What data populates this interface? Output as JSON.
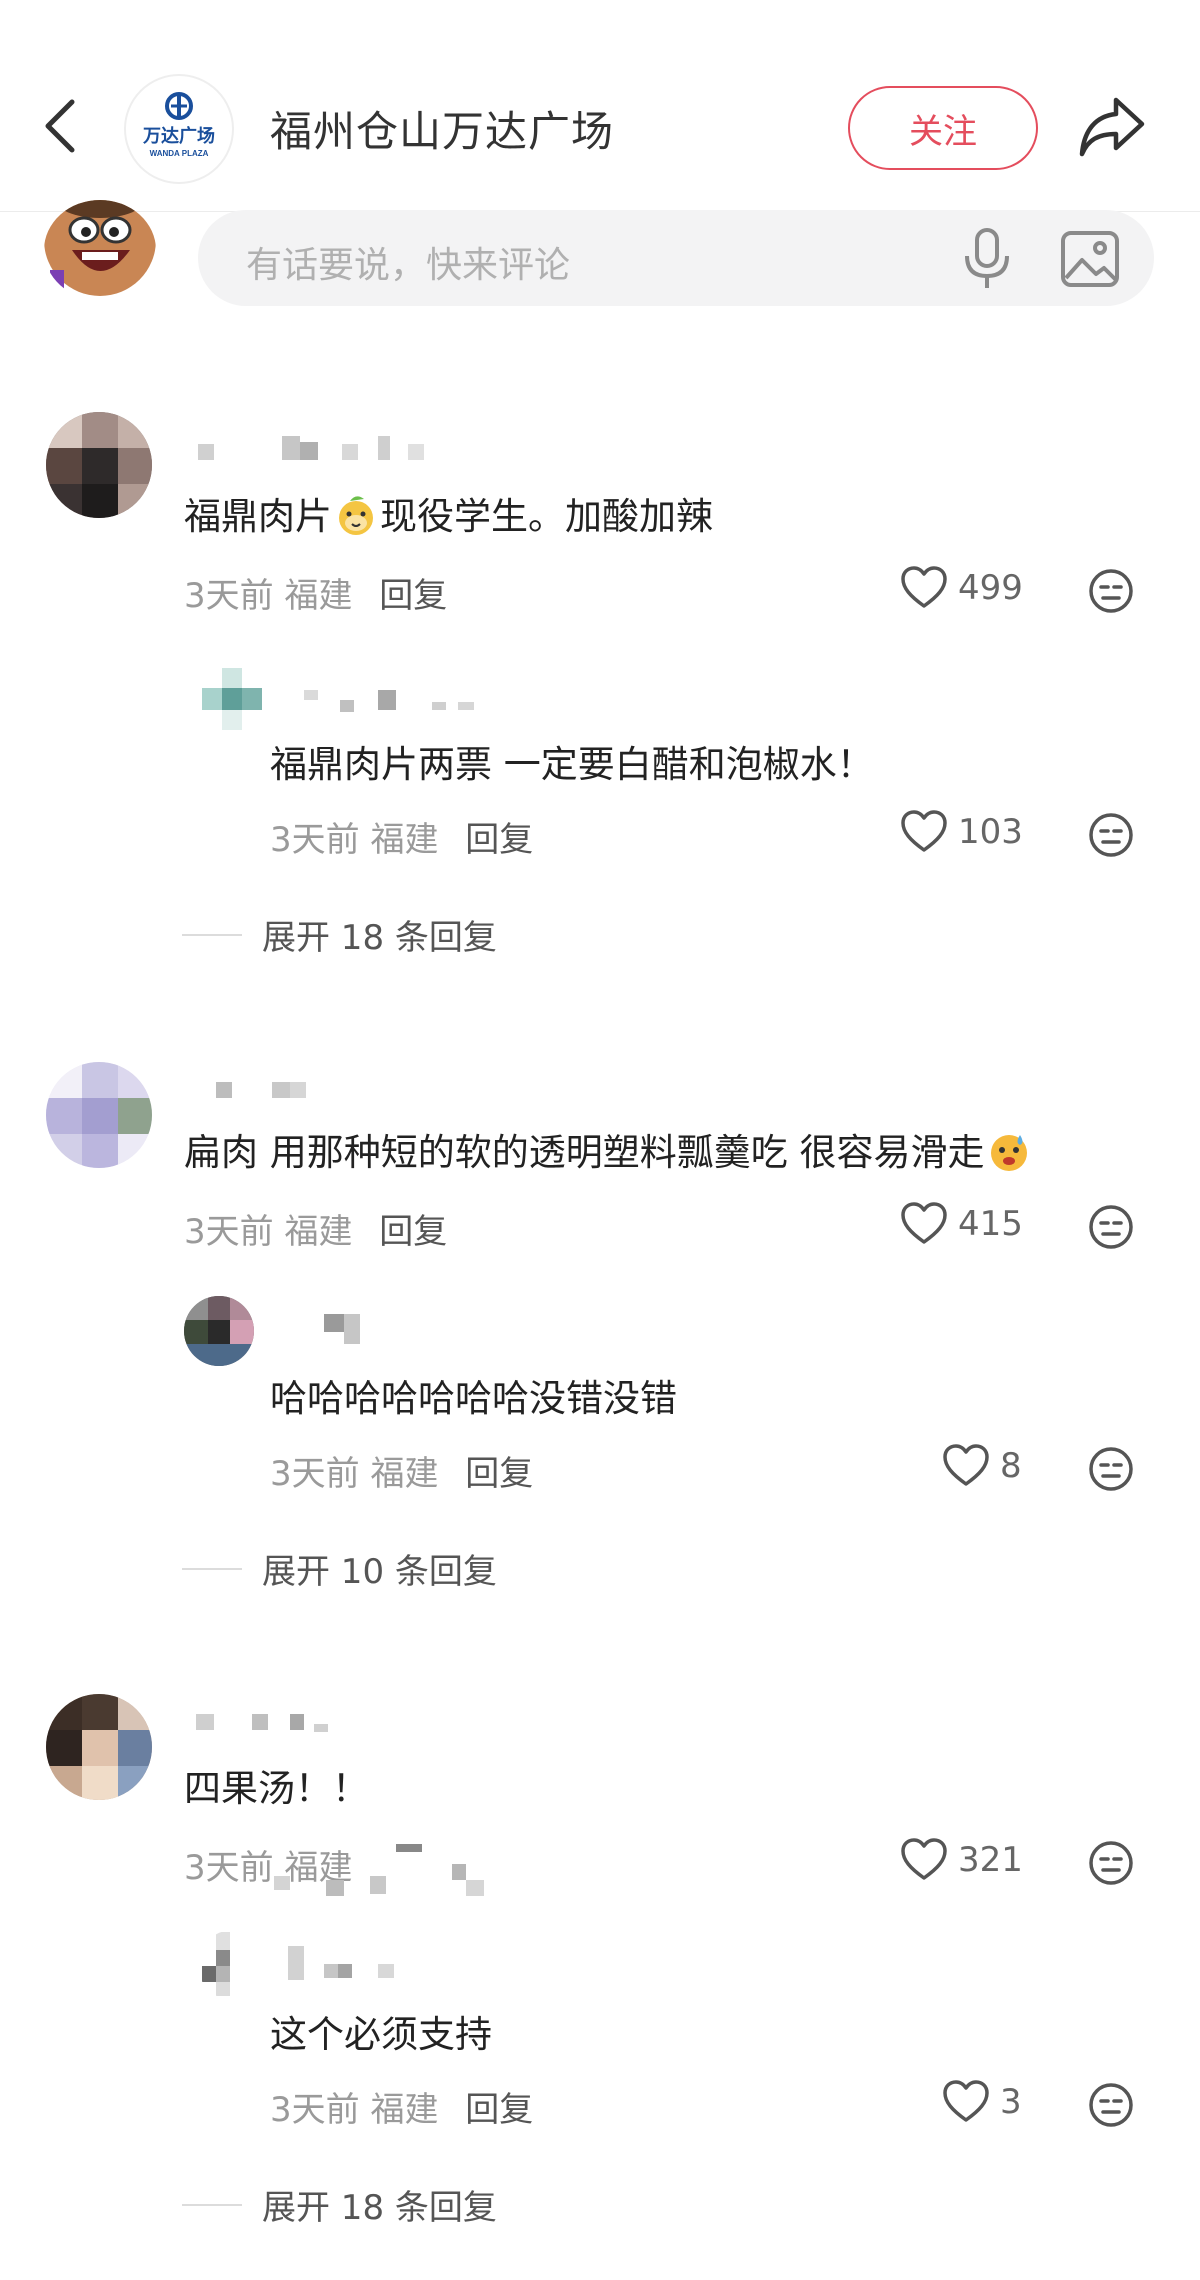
{
  "header": {
    "back_icon": "chevron-left-icon",
    "brand_logo_cn": "万达广场",
    "brand_logo_en": "WANDA PLAZA",
    "title": "福州仓山万达广场",
    "follow_label": "关注",
    "share_icon": "share-arrow-icon"
  },
  "composer": {
    "placeholder": "有话要说，快来评论",
    "mic_icon": "microphone-icon",
    "image_icon": "image-icon"
  },
  "comments": [
    {
      "text_before": "福鼎肉片",
      "emoji": "cheeky-face-emoji",
      "text_after": "现役学生。加酸加辣",
      "time": "3天前",
      "location": "福建",
      "reply_label": "回复",
      "likes": "499",
      "reply": {
        "text": "福鼎肉片两票 一定要白醋和泡椒水！",
        "time": "3天前",
        "location": "福建",
        "reply_label": "回复",
        "likes": "103"
      },
      "expand_label": "展开 18 条回复"
    },
    {
      "text_before": "扁肉 用那种短的软的透明塑料瓢羹吃 很容易滑走",
      "emoji": "sweat-smile-emoji",
      "text_after": "",
      "time": "3天前",
      "location": "福建",
      "reply_label": "回复",
      "likes": "415",
      "reply": {
        "text": "哈哈哈哈哈哈哈没错没错",
        "time": "3天前",
        "location": "福建",
        "reply_label": "回复",
        "likes": "8"
      },
      "expand_label": "展开 10 条回复"
    },
    {
      "text_before": "四果汤！！",
      "emoji": "",
      "text_after": "",
      "time": "3天前",
      "location": "福建",
      "reply_label": "",
      "likes": "321",
      "reply": {
        "text": "这个必须支持",
        "time": "3天前",
        "location": "福建",
        "reply_label": "回复",
        "likes": "3"
      },
      "expand_label": "展开 18 条回复"
    }
  ],
  "colors": {
    "accent": "#e44d5d",
    "meta_gray": "#9a9a9a",
    "input_bg": "#f3f3f4"
  }
}
